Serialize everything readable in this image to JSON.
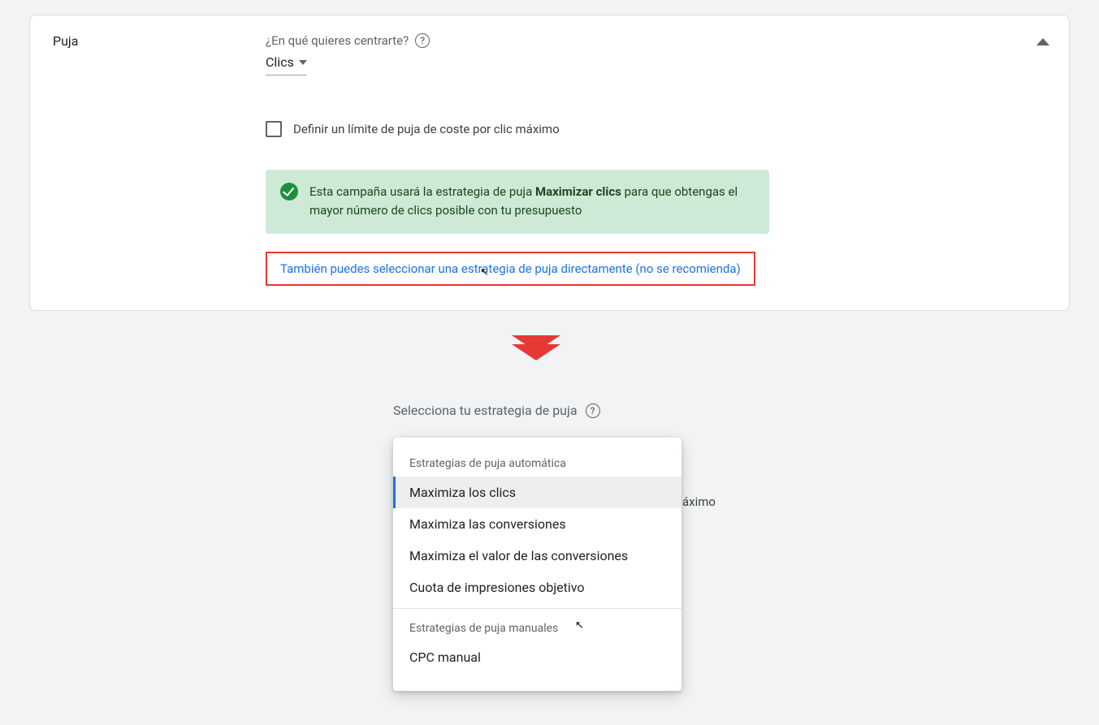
{
  "card": {
    "title": "Puja",
    "focus_label": "¿En qué quieres centrarte?",
    "dropdown_value": "Clics",
    "checkbox_label": "Definir un límite de puja de coste por clic máximo",
    "banner_prefix": "Esta campaña usará la estrategia de puja ",
    "banner_bold": "Maximizar clics",
    "banner_suffix": " para que obtengas el mayor número de clics posible con tu presupuesto",
    "direct_link": "También puedes seleccionar una estrategia de puja directamente (no se recomienda)"
  },
  "section2": {
    "label": "Selecciona tu estrategia de puja",
    "background_text_fragment": "áximo",
    "group_auto": "Estrategias de puja automática",
    "group_manual": "Estrategias de puja manuales",
    "items_auto": {
      "0": "Maximiza los clics",
      "1": "Maximiza las conversiones",
      "2": "Maximiza el valor de las conversiones",
      "3": "Cuota de impresiones objetivo"
    },
    "items_manual": {
      "0": "CPC manual"
    }
  }
}
